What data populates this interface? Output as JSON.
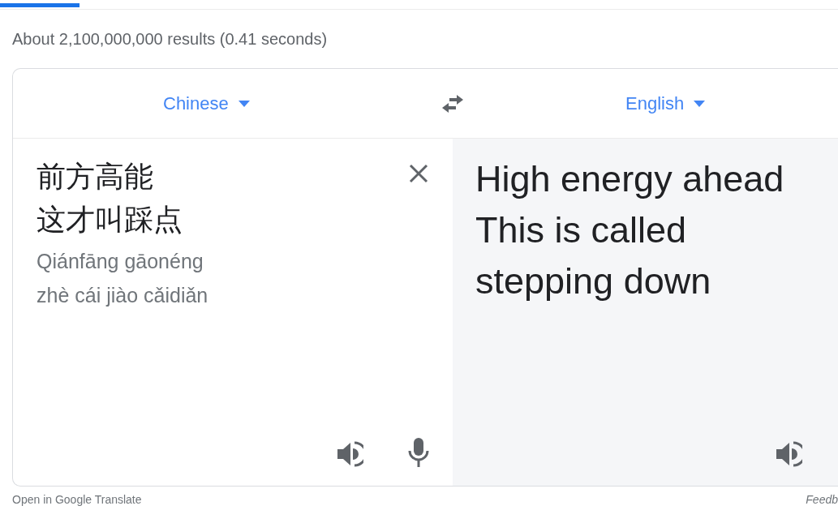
{
  "result_stats": "About 2,100,000,000 results (0.41 seconds)",
  "translator": {
    "source_language": "Chinese",
    "target_language": "English",
    "source_lines": [
      "前方高能",
      "这才叫踩点"
    ],
    "pinyin_lines": [
      "Qiánfāng gāonéng",
      "zhè cái jiào cǎidiǎn"
    ],
    "translation_lines": [
      "High energy ahead",
      "This is called",
      "stepping down"
    ]
  },
  "footer": {
    "link": "Open in Google Translate",
    "feedback": "Feedb"
  }
}
